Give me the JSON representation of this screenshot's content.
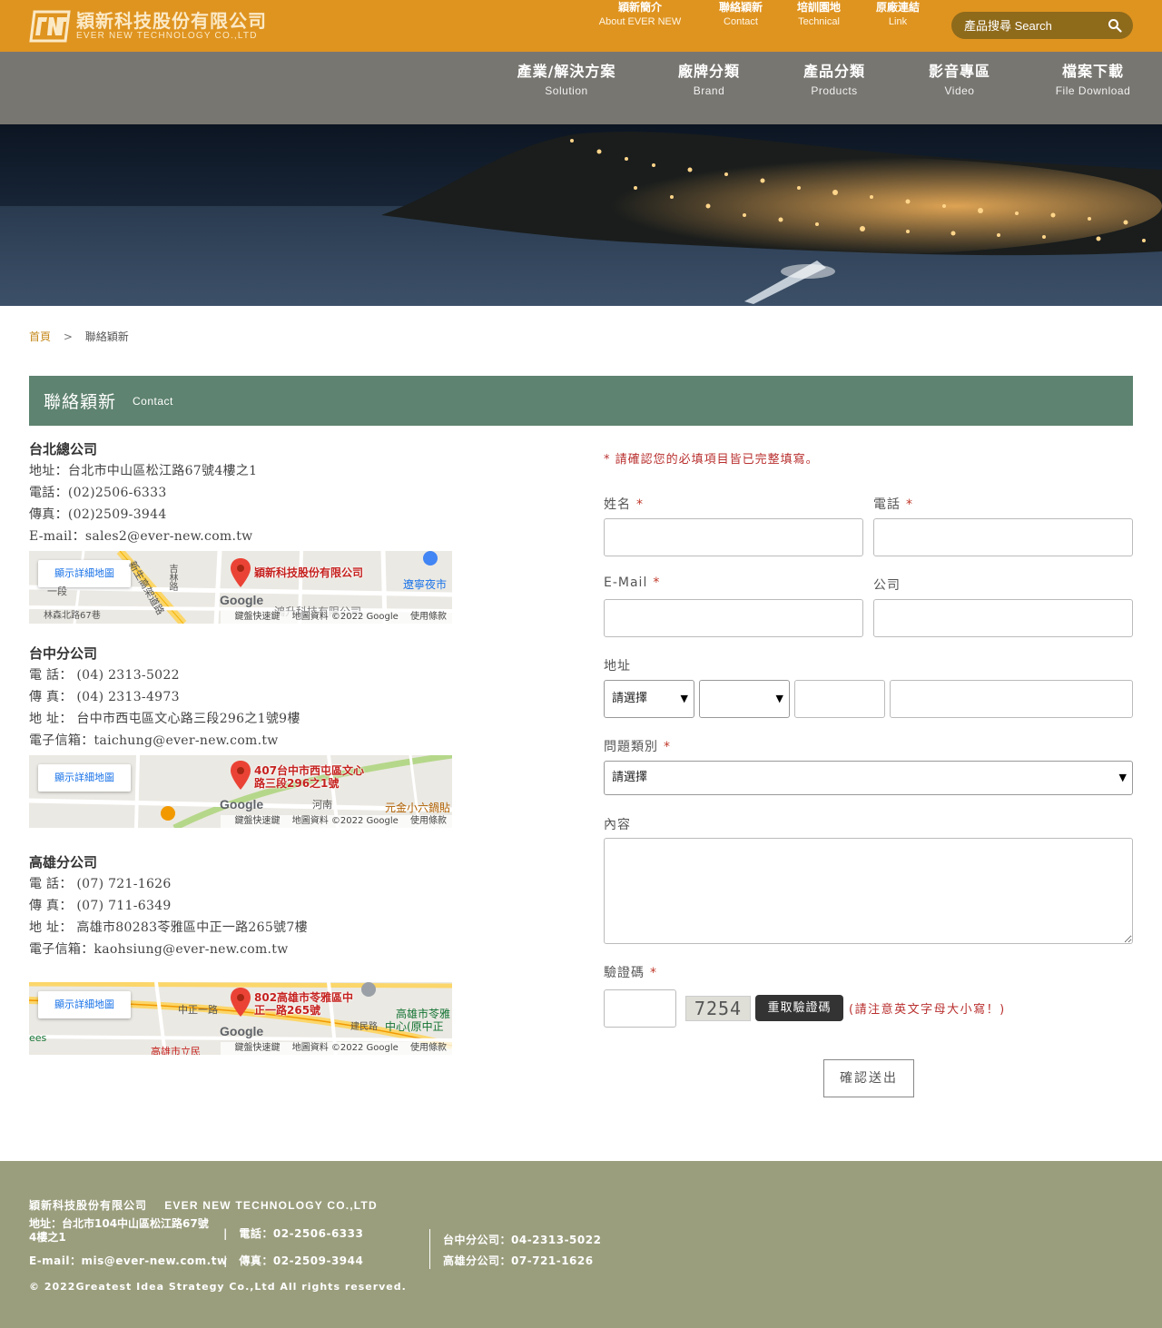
{
  "header": {
    "logo_cn": "穎新科技股份有限公司",
    "logo_en": "EVER NEW TECHNOLOGY CO.,LTD",
    "top_links": [
      {
        "cn": "穎新簡介",
        "en": "About EVER NEW"
      },
      {
        "cn": "聯絡穎新",
        "en": "Contact"
      },
      {
        "cn": "培訓園地",
        "en": "Technical"
      },
      {
        "cn": "原廠連結",
        "en": "Link"
      }
    ],
    "search_placeholder": "產品搜尋 Search",
    "bar_color": "#df9420"
  },
  "nav": [
    {
      "cn": "產業/解決方案",
      "en": "Solution"
    },
    {
      "cn": "廠牌分類",
      "en": "Brand"
    },
    {
      "cn": "產品分類",
      "en": "Products"
    },
    {
      "cn": "影音專區",
      "en": "Video"
    },
    {
      "cn": "檔案下載",
      "en": "File Download"
    }
  ],
  "breadcrumb": {
    "home": "首頁",
    "sep": ">",
    "current": "聯絡穎新"
  },
  "section": {
    "title_cn": "聯絡穎新",
    "title_en": "Contact",
    "color": "#5e8370"
  },
  "offices": [
    {
      "name": "台北總公司",
      "lines": [
        "地址：台北市中山區松江路67號4樓之1",
        "電話：(02)2506-6333",
        "傳真：(02)2509-3944",
        "E-mail：sales2@ever-new.com.tw"
      ],
      "map_label": "穎新科技股份有限公司"
    },
    {
      "name": "台中分公司",
      "lines": [
        "電 話： (04) 2313-5022",
        "傳 真： (04) 2313-4973",
        "地 址： 台中市西屯區文心路三段296之1號9樓",
        "電子信箱：taichung@ever-new.com.tw"
      ],
      "map_label": "407台中市西屯區文心路三段296之1號"
    },
    {
      "name": "高雄分公司",
      "lines": [
        "電 話： (07) 721-1626",
        "傳 真： (07) 711-6349",
        "地 址： 高雄市80283苓雅區中正一路265號7樓",
        "電子信箱：kaohsiung@ever-new.com.tw"
      ],
      "map_label": "802高雄市苓雅區中正一路265號"
    }
  ],
  "map": {
    "detail_button": "顯示詳細地圖",
    "google": "Google",
    "footer_shortcuts": "鍵盤快速鍵",
    "footer_data": "地圖資料 ©2022 Google",
    "footer_terms": "使用條款",
    "taipei_places": [
      "遼寧夜市",
      "吉林路",
      "林森北路67巷",
      "新生高架道路",
      "一段",
      "鴻升科技有限公司"
    ],
    "taichung_places": [
      "元金小六鍋貼",
      "河南"
    ],
    "kaohsiung_places": [
      "高雄市苓雅",
      "中心(原中正",
      "中正一路",
      "建民路",
      "高雄市立民",
      "ees"
    ]
  },
  "form": {
    "notice": "* 請確認您的必填項目皆已完整填寫。",
    "name_label": "姓名",
    "phone_label": "電話",
    "email_label": "E-Mail",
    "company_label": "公司",
    "address_label": "地址",
    "address_select_1": "請選擇",
    "address_select_2": "",
    "question_label": "問題類別",
    "question_select": "請選擇",
    "content_label": "內容",
    "captcha_label": "驗證碼",
    "captcha_code": "7254",
    "captcha_refresh": "重取驗證碼",
    "captcha_note": "(請注意英文字母大小寫！)",
    "required_mark": "*",
    "submit": "確認送出"
  },
  "footer": {
    "company_cn": "穎新科技股份有限公司",
    "company_en": "EVER NEW TECHNOLOGY CO.,LTD",
    "address": "地址：台北市104中山區松江路67號4樓之1",
    "phone": "|　電話：02-2506-6333",
    "email": "E-mail：mis@ever-new.com.tw",
    "fax": "|　傳真：02-2509-3944",
    "taichung": "台中分公司：04-2313-5022",
    "kaohsiung": "高雄分公司：07-721-1626",
    "copyright": "© 2022Greatest Idea Strategy Co.,Ltd All rights reserved.",
    "color": "#9b9e7d"
  }
}
